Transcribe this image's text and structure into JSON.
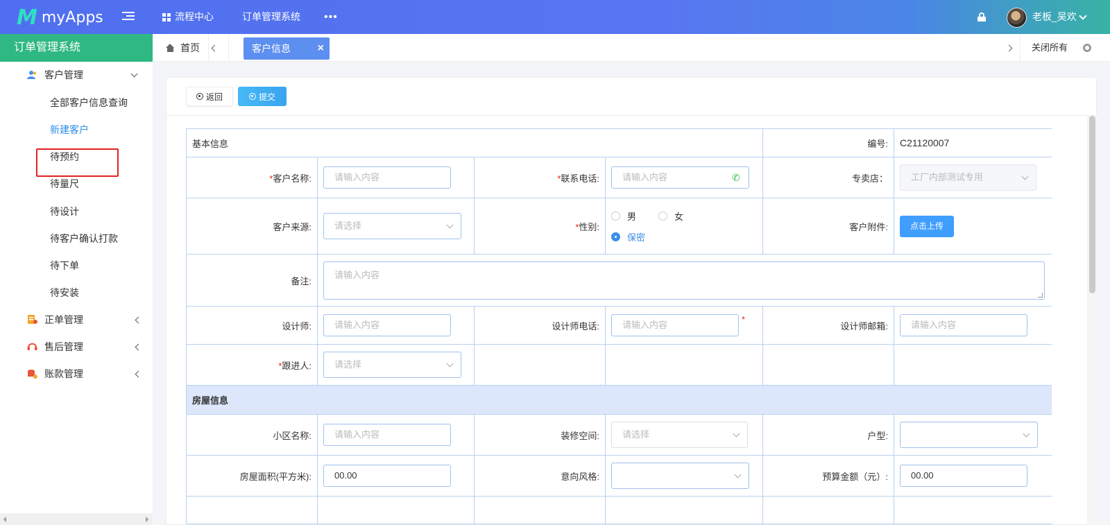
{
  "topbar": {
    "logo_mark": "M",
    "app_name": "myApps",
    "nav": [
      {
        "label": "流程中心"
      },
      {
        "label": "订单管理系统"
      },
      {
        "label": "•••"
      }
    ],
    "username": "老板_吴欢"
  },
  "sidebar": {
    "system_title": "订单管理系统",
    "groups": [
      {
        "label": "客户管理",
        "icon": "user-group-icon",
        "expanded": true,
        "items": [
          "全部客户信息查询",
          "新建客户",
          "待预约",
          "待量尺",
          "待设计",
          "待客户确认打款",
          "待下单",
          "待安装"
        ],
        "active_item": "新建客户"
      },
      {
        "label": "正单管理",
        "icon": "document-icon",
        "expanded": false
      },
      {
        "label": "售后管理",
        "icon": "headset-icon",
        "expanded": false
      },
      {
        "label": "账款管理",
        "icon": "ledger-icon",
        "expanded": false
      }
    ]
  },
  "tabs": {
    "home_label": "首页",
    "active_label": "客户信息",
    "close_all_label": "关闭所有"
  },
  "toolbar": {
    "back_label": "返回",
    "submit_label": "提交"
  },
  "form": {
    "basic_title": "基本信息",
    "code_label": "编号:",
    "code_value": "C21120007",
    "customer_name_label": "客户名称:",
    "customer_name_placeholder": "请输入内容",
    "phone_label": "联系电话:",
    "phone_placeholder": "请输入内容",
    "store_label": "专卖店：",
    "store_value": "工厂内部测试专用",
    "source_label": "客户来源:",
    "source_placeholder": "请选择",
    "gender_label": "性别:",
    "gender_options": [
      "男",
      "女",
      "保密"
    ],
    "gender_selected": "保密",
    "attachment_label": "客户附件:",
    "upload_label": "点击上传",
    "remark_label": "备注:",
    "remark_placeholder": "请输入内容",
    "designer_label": "设计师:",
    "designer_placeholder": "请输入内容",
    "designer_phone_label": "设计师电话:",
    "designer_phone_placeholder": "请输入内容",
    "designer_email_label": "设计师邮箱:",
    "designer_email_placeholder": "请输入内容",
    "follower_label": "跟进人:",
    "follower_placeholder": "请选择",
    "house_title": "房屋信息",
    "community_label": "小区名称:",
    "community_placeholder": "请输入内容",
    "decor_space_label": "装修空间:",
    "decor_space_placeholder": "请选择",
    "layout_label": "户型:",
    "area_label": "房屋面积(平方米):",
    "area_value": "00.00",
    "style_label": "意向风格:",
    "budget_label": "预算金额（元）:",
    "budget_value": "00.00",
    "required_mark": "*"
  },
  "colors": {
    "topbar_start": "#4f6ff0",
    "topbar_end": "#37b3a4",
    "system_title_bg": "#2fb883",
    "active_tab": "#5d8ff0",
    "primary": "#409eff",
    "required": "#e52020",
    "highlight_box": "#e52020"
  }
}
